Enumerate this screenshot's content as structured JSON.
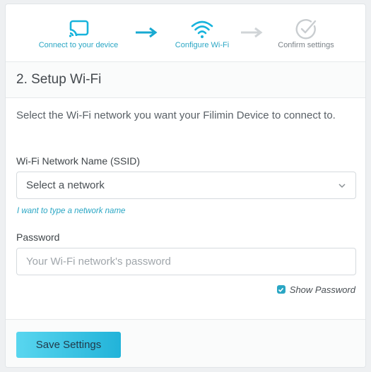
{
  "steps": [
    {
      "label": "Connect to your device",
      "icon": "cast-icon",
      "state": "complete"
    },
    {
      "label": "Configure Wi-Fi",
      "icon": "wifi-icon",
      "state": "active"
    },
    {
      "label": "Confirm settings",
      "icon": "check-circle-icon",
      "state": "pending"
    }
  ],
  "section": {
    "title": "2. Setup Wi-Fi"
  },
  "description": "Select the Wi-Fi network you want your Filimin Device to connect to.",
  "network": {
    "label": "Wi-Fi Network Name (SSID)",
    "selected": "Select a network",
    "manual_link": "I want to type a network name"
  },
  "password": {
    "label": "Password",
    "placeholder": "Your Wi-Fi network's password",
    "value": "",
    "show_label": "Show Password",
    "show_checked": true
  },
  "footer": {
    "save_label": "Save Settings"
  },
  "colors": {
    "accent": "#2aa6c4",
    "active_arrow": "#17a9d1",
    "inactive": "#c9cdd0",
    "button_start": "#59d6ef",
    "button_end": "#22b3d9"
  }
}
